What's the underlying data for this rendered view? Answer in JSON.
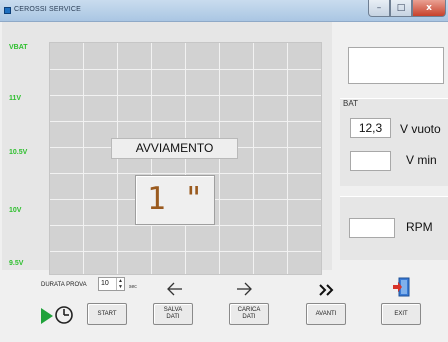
{
  "window": {
    "title": "CEROSSI SERVICE",
    "min": "–",
    "max": "□",
    "close": "x"
  },
  "graph": {
    "y_labels": [
      "VBAT",
      "11V",
      "10.5V",
      "10V",
      "9.5V"
    ]
  },
  "status_text": "AVVIAMENTO",
  "timer_text": "1 \"",
  "battery": {
    "group_label": "BAT",
    "voltage_value": "12,3",
    "vvuoto_label": "V vuoto",
    "vmin_label": "V min",
    "vmin_value": ""
  },
  "top_display_value": "",
  "rpm": {
    "label": "RPM",
    "value": ""
  },
  "durata": {
    "label": "DURATA PROVA",
    "value": "10",
    "unit": "sec"
  },
  "buttons": {
    "start": "START",
    "salva_line1": "SALVA",
    "salva_line2": "DATI",
    "carica_line1": "CARICA",
    "carica_line2": "DATI",
    "avanti": "AVANTI",
    "exit": "EXIT"
  },
  "icons": {
    "start": "play-timer-icon",
    "salva": "arrow-left-save-icon",
    "carica": "arrow-right-load-icon",
    "avanti": "double-chevron-right-icon",
    "exit": "exit-door-icon"
  },
  "colors": {
    "axis_label": "#2dbf2d",
    "timer_text": "#9a5a1e",
    "start_icon": "#1fa23a",
    "exit_icon": "#d8332a"
  }
}
